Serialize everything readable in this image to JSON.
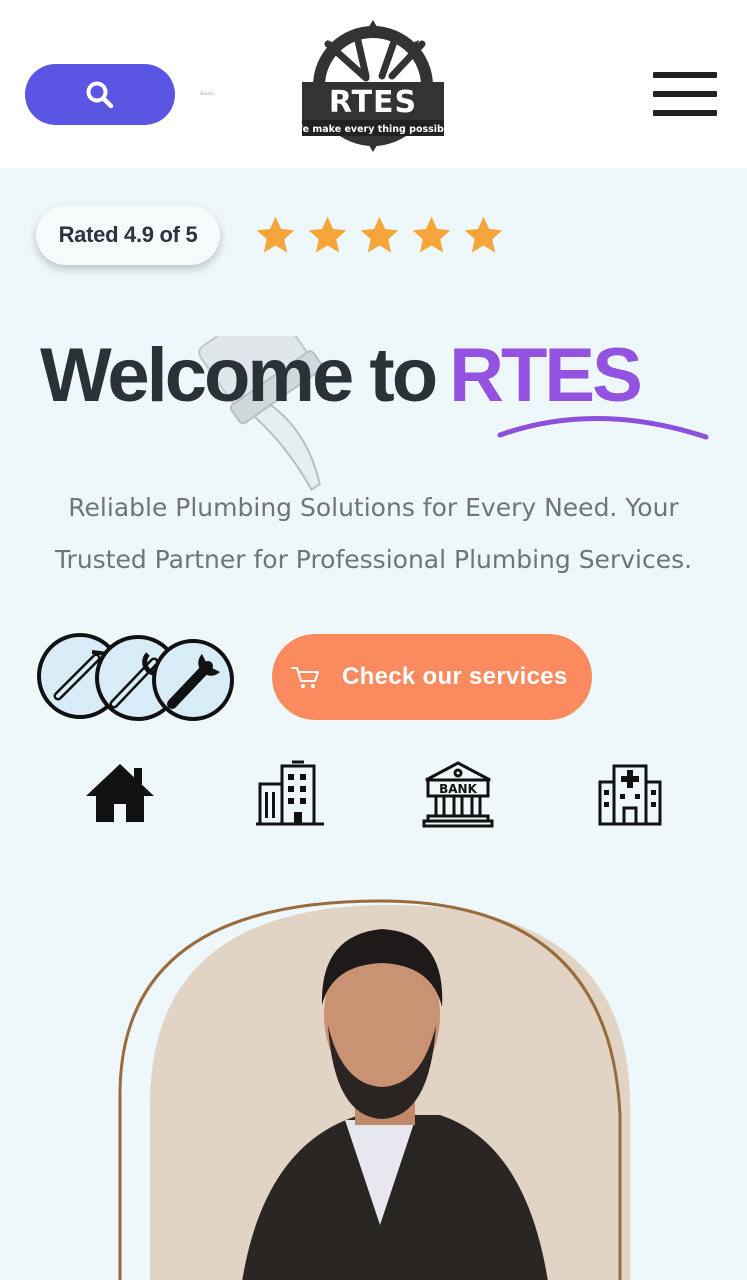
{
  "header": {
    "search_tiny_text": "Search",
    "logo": {
      "brand": "RTES",
      "tagline": "We make every thing possible"
    }
  },
  "hero": {
    "rating_text": "Rated 4.9 of 5",
    "stars_filled": 5,
    "stars_total": 5,
    "headline_prefix": "Welcome to",
    "headline_brand": "RTES",
    "subtitle_line1": "Reliable Plumbing Solutions for Every Need. Your",
    "subtitle_line2": "Trusted Partner for Professional Plumbing Services.",
    "cta_label": "Check our services"
  },
  "categories": [
    {
      "icon": "home-icon"
    },
    {
      "icon": "office-building-icon"
    },
    {
      "icon": "bank-icon",
      "label": "BANK"
    },
    {
      "icon": "hospital-icon"
    }
  ],
  "colors": {
    "search_button": "#5b55e3",
    "brand_purple": "#9353e0",
    "cta_orange": "#fb8a5f",
    "star_orange": "#f5a53a",
    "page_background": "#eef8fb",
    "profile_blob": "#e2d4c4",
    "profile_outline": "#9a6b3d"
  }
}
